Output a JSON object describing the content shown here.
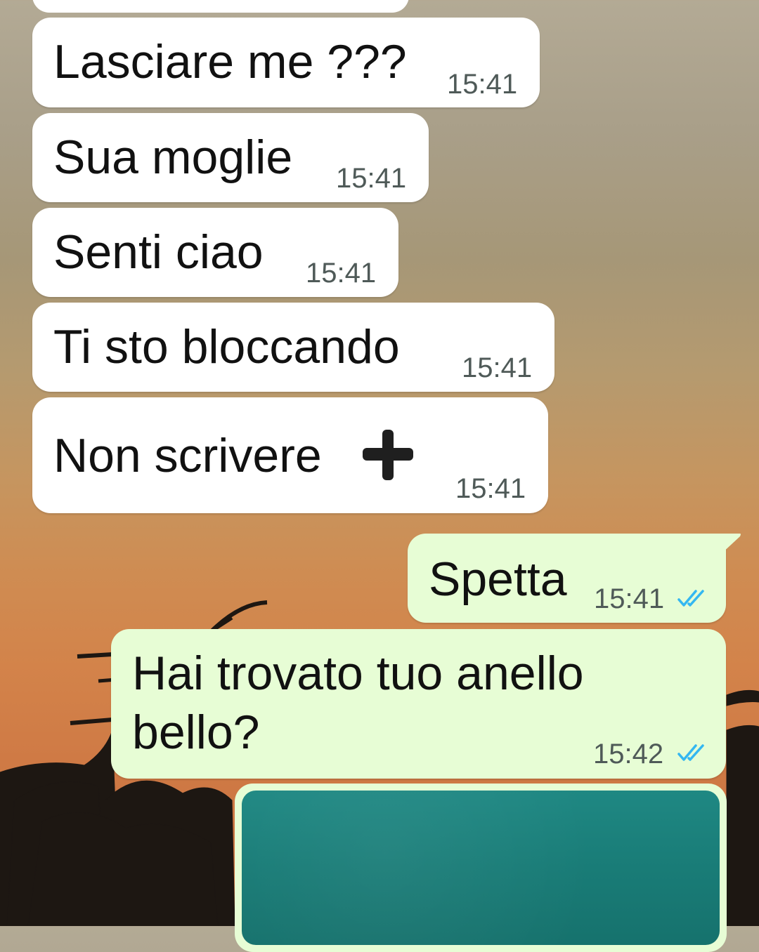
{
  "messages": [
    {
      "text": "Lasciare me ???",
      "time": "15:41",
      "dir": "in"
    },
    {
      "text": "Sua moglie",
      "time": "15:41",
      "dir": "in"
    },
    {
      "text": "Senti ciao",
      "time": "15:41",
      "dir": "in"
    },
    {
      "text": "Ti sto bloccando",
      "time": "15:41",
      "dir": "in"
    },
    {
      "text": "Non scrivere",
      "time": "15:41",
      "dir": "in",
      "emoji": "heavy-plus-icon"
    },
    {
      "text": "Spetta",
      "time": "15:41",
      "dir": "out",
      "status": "read"
    },
    {
      "text_line1": "Hai trovato tuo anello",
      "text_line2": "bello?",
      "time": "15:42",
      "dir": "out",
      "status": "read"
    }
  ],
  "colors": {
    "incoming_bubble": "#ffffff",
    "outgoing_bubble": "#e7fdd5",
    "read_ticks": "#34b7f1",
    "photo_preview": "#197c77"
  }
}
